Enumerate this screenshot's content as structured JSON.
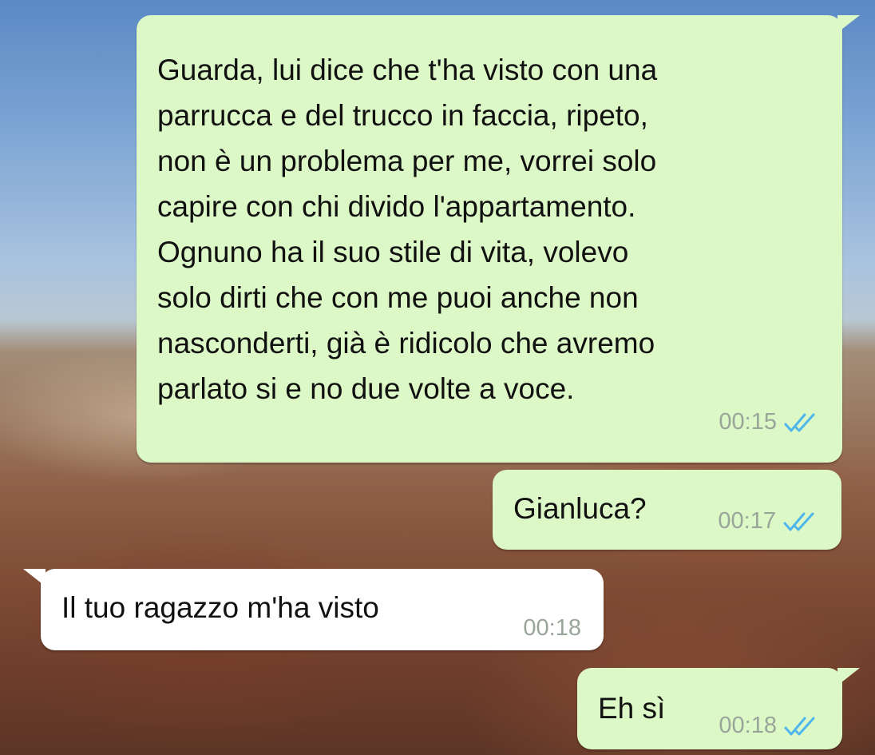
{
  "chat": {
    "messages": [
      {
        "direction": "outgoing",
        "text": "Guarda, lui dice che t'ha visto con una\nparrucca e del trucco in faccia, ripeto,\nnon è un problema per me, vorrei solo\ncapire con chi divido l'appartamento.\nOgnuno ha il suo stile di vita, volevo\nsolo dirti che con me puoi anche non\nnasconderti, già è ridicolo che avremo\nparlato si e no due volte a voce.",
        "time": "00:15",
        "status": "read-double-check-icon"
      },
      {
        "direction": "outgoing",
        "text": "Gianluca?",
        "time": "00:17",
        "status": "read-double-check-icon"
      },
      {
        "direction": "incoming",
        "text": "Il tuo ragazzo m'ha visto",
        "time": "00:18"
      },
      {
        "direction": "outgoing",
        "text": "Eh sì",
        "time": "00:18",
        "status": "read-double-check-icon"
      }
    ]
  },
  "colors": {
    "outgoing_bubble": "#dcf8c6",
    "incoming_bubble": "#ffffff",
    "read_ticks": "#4fb6ec",
    "timestamp": "#9aa59a"
  }
}
